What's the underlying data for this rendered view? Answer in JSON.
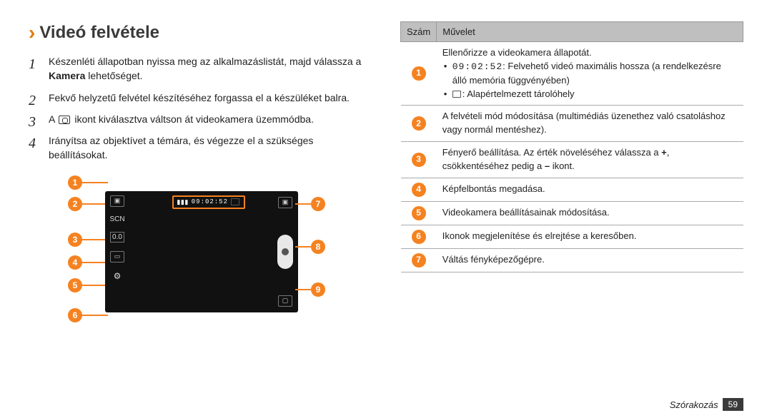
{
  "heading": "Videó felvétele",
  "steps": [
    {
      "pre": "Készenléti állapotban nyissa meg az alkalmazáslistát, majd válassza a ",
      "bold": "Kamera",
      "post": " lehetőséget."
    },
    {
      "pre": "Fekvő helyzetű felvétel készítéséhez forgassa el a készüléket balra."
    },
    {
      "pre_icon": "A ",
      "post_icon": " ikont kiválasztva váltson át videokamera üzemmódba."
    },
    {
      "pre": "Irányítsa az objektívet a témára, és végezze el a szükséges beállításokat."
    }
  ],
  "preview": {
    "status_time": "09:02:52",
    "side_labels": [
      "",
      "SCN",
      "0.0",
      "",
      ""
    ],
    "callouts_left": [
      "1",
      "2",
      "3",
      "4",
      "5",
      "6"
    ],
    "callouts_right": [
      "7",
      "8",
      "9"
    ]
  },
  "table": {
    "head_num": "Szám",
    "head_op": "Művelet",
    "rows": [
      {
        "num": "1",
        "lines": [
          "Ellenőrizze a videokamera állapotát.",
          {
            "bullet": true,
            "mono": "09:02:52",
            "rest": ": Felvehető videó maximális hossza (a rendelkezésre álló memória függvényében)"
          },
          {
            "bullet": true,
            "icon": "card",
            "rest": ": Alapértelmezett tárolóhely"
          }
        ]
      },
      {
        "num": "2",
        "text": "A felvételi mód módosítása (multimédiás üzenethez való csatoláshoz vagy normál mentéshez)."
      },
      {
        "num": "3",
        "text_parts": [
          "Fényerő beállítása. Az érték növeléséhez válassza a ",
          {
            "bold": "+"
          },
          ", csökkentéséhez pedig a ",
          {
            "bold": "–"
          },
          " ikont."
        ]
      },
      {
        "num": "4",
        "text": "Képfelbontás megadása."
      },
      {
        "num": "5",
        "text": "Videokamera beállításainak módosítása."
      },
      {
        "num": "6",
        "text": "Ikonok megjelenítése és elrejtése a keresőben."
      },
      {
        "num": "7",
        "text": "Váltás fényképezőgépre."
      }
    ]
  },
  "footer": {
    "section": "Szórakozás",
    "page": "59"
  }
}
